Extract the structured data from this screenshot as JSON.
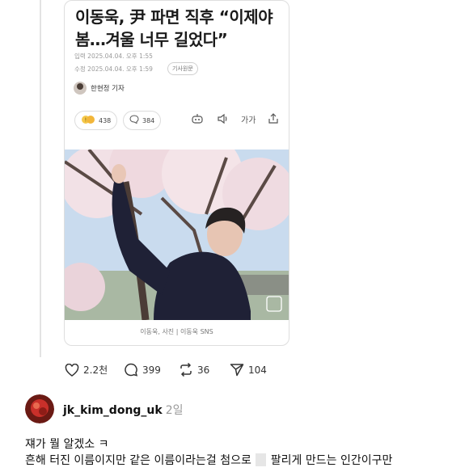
{
  "article": {
    "headline_line1": "이동욱, 尹 파면 직후 “이제야",
    "headline_line2": "봄…겨울 너무 길었다”",
    "published": "입력 2025.04.04. 오후 1:55",
    "modified": "수정 2025.04.04. 오후 1:59",
    "original_label": "기사원문",
    "reporter": "한현정 기자",
    "reaction_count": "438",
    "comment_count": "384",
    "font_size_label": "가가",
    "photo_caption": "이동욱, 사진 | 이동욱 SNS"
  },
  "post_actions": {
    "likes": "2.2천",
    "replies": "399",
    "reposts": "36",
    "shares": "104"
  },
  "comment": {
    "username": "jk_kim_dong_uk",
    "time": "2일",
    "line1": "쟤가 뭘 알겠소 ㅋ",
    "line2_before": "흔해 터진 이름이지만 같은 이름이라는걸 첨으로",
    "line2_after": "팔리게 만드는 인간이구만"
  },
  "colors": {
    "sky": "#c9dbee",
    "blossom": "#f2e1e6",
    "sweater": "#1f2136",
    "reaction_badge": "#f5c84a"
  }
}
